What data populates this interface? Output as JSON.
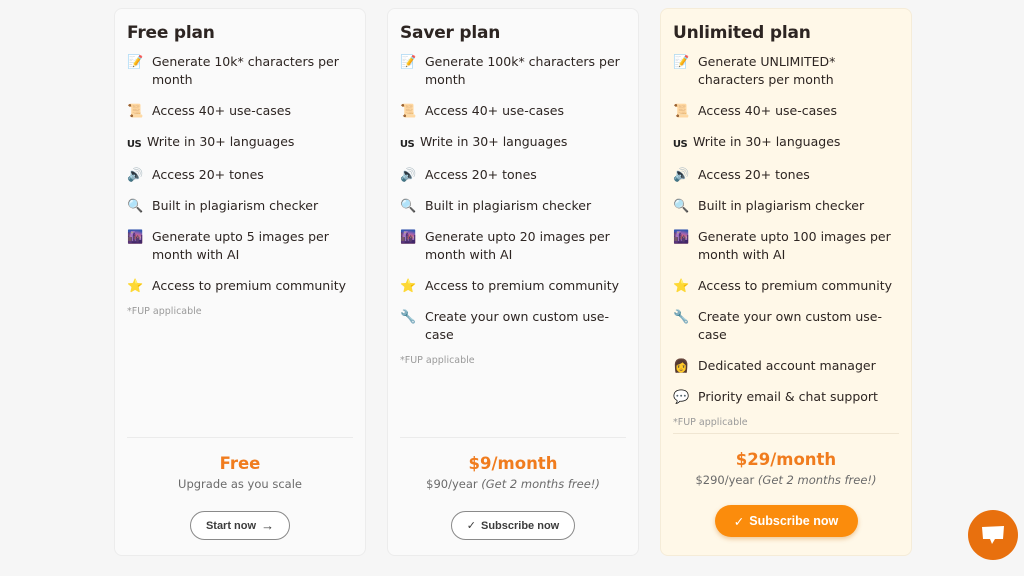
{
  "plans": [
    {
      "title": "Free plan",
      "features": [
        {
          "icon": "memo-icon",
          "glyph": "📝",
          "text": "Generate 10k* characters per month"
        },
        {
          "icon": "scroll-icon",
          "glyph": "📜",
          "text": "Access 40+ use-cases"
        },
        {
          "icon": "us-flag-icon",
          "glyph": "US",
          "text": "Write in 30+ languages"
        },
        {
          "icon": "speaker-icon",
          "glyph": "🔊",
          "text": "Access 20+ tones"
        },
        {
          "icon": "magnifier-icon",
          "glyph": "🔍",
          "text": "Built in plagiarism checker"
        },
        {
          "icon": "cityscape-icon",
          "glyph": "🌆",
          "text": "Generate upto 5 images per month with AI"
        },
        {
          "icon": "star-icon",
          "glyph": "⭐",
          "text": "Access to premium community"
        }
      ],
      "fup": "*FUP applicable",
      "price": "Free",
      "sub_main": "Upgrade as you scale",
      "sub_note": "",
      "button": {
        "label": "Start now",
        "icon": "arrow-right-icon",
        "glyph": "→"
      }
    },
    {
      "title": "Saver plan",
      "features": [
        {
          "icon": "memo-icon",
          "glyph": "📝",
          "text": "Generate 100k* characters per month"
        },
        {
          "icon": "scroll-icon",
          "glyph": "📜",
          "text": "Access 40+ use-cases"
        },
        {
          "icon": "us-flag-icon",
          "glyph": "US",
          "text": "Write in 30+ languages"
        },
        {
          "icon": "speaker-icon",
          "glyph": "🔊",
          "text": "Access 20+ tones"
        },
        {
          "icon": "magnifier-icon",
          "glyph": "🔍",
          "text": "Built in plagiarism checker"
        },
        {
          "icon": "cityscape-icon",
          "glyph": "🌆",
          "text": "Generate upto 20 images per month with AI"
        },
        {
          "icon": "star-icon",
          "glyph": "⭐",
          "text": "Access to premium community"
        },
        {
          "icon": "wrench-icon",
          "glyph": "🔧",
          "text": "Create your own custom use-case"
        }
      ],
      "fup": "*FUP applicable",
      "price": "$9/month",
      "sub_main": "$90/year",
      "sub_note": "(Get 2 months free!)",
      "button": {
        "label": "Subscribe now",
        "icon": "check-icon",
        "glyph": "✓"
      }
    },
    {
      "title": "Unlimited plan",
      "features": [
        {
          "icon": "memo-icon",
          "glyph": "📝",
          "text": "Generate UNLIMITED* characters per month"
        },
        {
          "icon": "scroll-icon",
          "glyph": "📜",
          "text": "Access 40+ use-cases"
        },
        {
          "icon": "us-flag-icon",
          "glyph": "US",
          "text": "Write in 30+ languages"
        },
        {
          "icon": "speaker-icon",
          "glyph": "🔊",
          "text": "Access 20+ tones"
        },
        {
          "icon": "magnifier-icon",
          "glyph": "🔍",
          "text": "Built in plagiarism checker"
        },
        {
          "icon": "cityscape-icon",
          "glyph": "🌆",
          "text": "Generate upto 100 images per month with AI"
        },
        {
          "icon": "star-icon",
          "glyph": "⭐",
          "text": "Access to premium community"
        },
        {
          "icon": "wrench-icon",
          "glyph": "🔧",
          "text": "Create your own custom use-case"
        },
        {
          "icon": "account-manager-icon",
          "glyph": "👩",
          "text": "Dedicated account manager"
        },
        {
          "icon": "speech-bubble-icon",
          "glyph": "💬",
          "text": "Priority email & chat support"
        }
      ],
      "fup": "*FUP applicable",
      "price": "$29/month",
      "sub_main": "$290/year",
      "sub_note": "(Get 2 months free!)",
      "button": {
        "label": "Subscribe now",
        "icon": "check-icon",
        "glyph": "✓"
      }
    }
  ],
  "chat_widget": {
    "icon": "chat-bubble-icon"
  },
  "colors": {
    "accent": "#f07c1e",
    "primary_button": "#fb8c0c",
    "highlight_card": "#fff8e8",
    "chat_fab": "#e8700e"
  }
}
